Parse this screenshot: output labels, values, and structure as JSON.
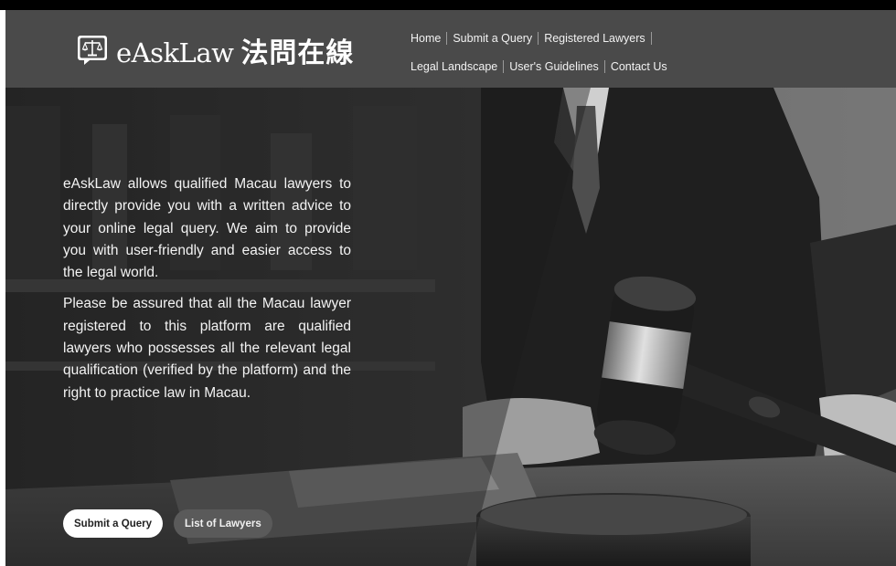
{
  "brand": {
    "name": "eAskLaw",
    "name_cjk": "法問在線",
    "logo_icon": "scales-chat-icon"
  },
  "nav": {
    "row1": [
      "Home",
      "Submit a Query",
      "Registered Lawyers"
    ],
    "row2": [
      "Legal Landscape",
      "User's Guidelines",
      "Contact Us"
    ]
  },
  "hero": {
    "paragraph1": "eAskLaw allows qualified Macau lawyers to directly provide you with a written advice to your online legal query. We aim to provide you with user-friendly and easier access to the legal world.",
    "paragraph2": "Please be assured that all the Macau lawyer registered to this platform are qualified lawyers who possesses all the relevant legal qualification (verified by the platform) and the right to practice law in Macau.",
    "primary_button": "Submit a Query",
    "secondary_button": "List of Lawyers",
    "background_image": "gavel-and-lawyer-photo"
  },
  "colors": {
    "header_bg": "#4a4a4a",
    "text": "#f3f3f3",
    "button_primary_bg": "#ffffff",
    "button_secondary_bg": "#5a5a5a"
  }
}
